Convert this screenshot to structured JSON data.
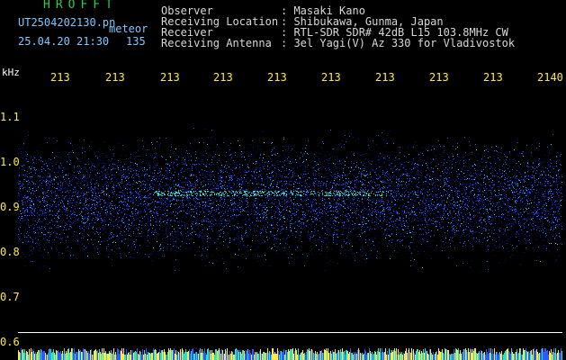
{
  "header": {
    "app_title": "HROFFT",
    "file_name": "UT2504202130.pn",
    "mode_label": "meteor",
    "date_time": "25.04.20 21:30",
    "count": "135"
  },
  "metadata": [
    {
      "key": "Observer",
      "value": ": Masaki Kano"
    },
    {
      "key": "Receiving Location",
      "value": ": Shibukawa, Gunma, Japan"
    },
    {
      "key": "Receiver",
      "value": ": RTL-SDR SDR# 42dB L15 103.8MHz CW"
    },
    {
      "key": "Receiving Antenna",
      "value": ": 3el Yagi(V) Az 330 for Vladivostok"
    }
  ],
  "axis": {
    "freq_unit": "kHz",
    "freq_ticks": [
      "1.1",
      "1.0",
      "0.9",
      "0.8",
      "0.7",
      "0.6"
    ],
    "time_ticks": [
      "213",
      "213",
      "213",
      "213",
      "213",
      "213",
      "213",
      "213",
      "213",
      "2140"
    ]
  },
  "colors": {
    "background": "#000000",
    "signal_low": "#0a1aa0",
    "signal_mid": "#2a5bff",
    "signal_high": "#2be0d0",
    "tick_color": "#ffeb3b"
  }
}
